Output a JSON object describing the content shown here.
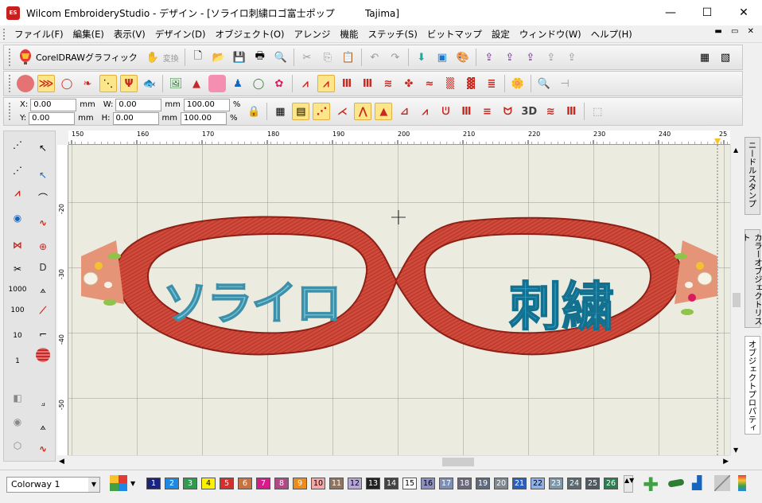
{
  "window": {
    "title": "Wilcom EmbroideryStudio - デザイン - [ソライロ刺繍ロゴ富士ポップ          Tajima]",
    "app_icon_text": "ES"
  },
  "menu": [
    "ファイル(F)",
    "編集(E)",
    "表示(V)",
    "デザイン(D)",
    "オブジェクト(O)",
    "アレンジ",
    "機能",
    "ステッチ(S)",
    "ビットマップ",
    "設定",
    "ウィンドウ(W)",
    "ヘルプ(H)"
  ],
  "toolbar": {
    "corel_label": "CorelDRAWグラフィック",
    "convert_label": "変換"
  },
  "props": {
    "x_label": "X:",
    "x_value": "0.00",
    "y_label": "Y:",
    "y_value": "0.00",
    "w_label": "W:",
    "w_value": "0.00",
    "h_label": "H:",
    "h_value": "0.00",
    "unit": "mm",
    "scale_w": "100.00",
    "scale_h": "100.00",
    "pct": "%",
    "stitch3d_label": "3D"
  },
  "left_tools": {
    "val1000": "1000",
    "val100": "100",
    "val10": "10",
    "val1": "1"
  },
  "ruler": {
    "top_ticks": [
      "150",
      "160",
      "170",
      "180",
      "190",
      "200",
      "210",
      "220",
      "230",
      "240",
      "25"
    ],
    "left_ticks": [
      "-20",
      "-30",
      "-40",
      "-50"
    ]
  },
  "design": {
    "left_text": "ソライロ",
    "right_text": "刺繍"
  },
  "right_tabs": [
    "ニードルスタンプ",
    "カラーオブジェクトリスト",
    "オブジェクトプロパティ"
  ],
  "status": {
    "colorway": "Colorway 1",
    "swatches": [
      {
        "n": "1",
        "c": "#1a237e"
      },
      {
        "n": "2",
        "c": "#1e88e5"
      },
      {
        "n": "3",
        "c": "#2e9b4f"
      },
      {
        "n": "4",
        "c": "#fff200"
      },
      {
        "n": "5",
        "c": "#d32f2f"
      },
      {
        "n": "6",
        "c": "#c9713f"
      },
      {
        "n": "7",
        "c": "#d81b8a"
      },
      {
        "n": "8",
        "c": "#b04a85"
      },
      {
        "n": "9",
        "c": "#ef8a1c"
      },
      {
        "n": "10",
        "c": "#f4a7a7"
      },
      {
        "n": "11",
        "c": "#8f7560"
      },
      {
        "n": "12",
        "c": "#b5a7d6"
      },
      {
        "n": "13",
        "c": "#222222"
      },
      {
        "n": "14",
        "c": "#444444"
      },
      {
        "n": "15",
        "c": "#ffffff"
      },
      {
        "n": "16",
        "c": "#8d8fbd"
      },
      {
        "n": "17",
        "c": "#7d8fb5"
      },
      {
        "n": "18",
        "c": "#6a6a7a"
      },
      {
        "n": "19",
        "c": "#5f6b7d"
      },
      {
        "n": "20",
        "c": "#7d8890"
      },
      {
        "n": "21",
        "c": "#2a5fbf"
      },
      {
        "n": "22",
        "c": "#8fb0e6"
      },
      {
        "n": "23",
        "c": "#7e97a8"
      },
      {
        "n": "24",
        "c": "#5a6a70"
      },
      {
        "n": "25",
        "c": "#4e5a60"
      },
      {
        "n": "26",
        "c": "#2e7d52"
      }
    ]
  }
}
